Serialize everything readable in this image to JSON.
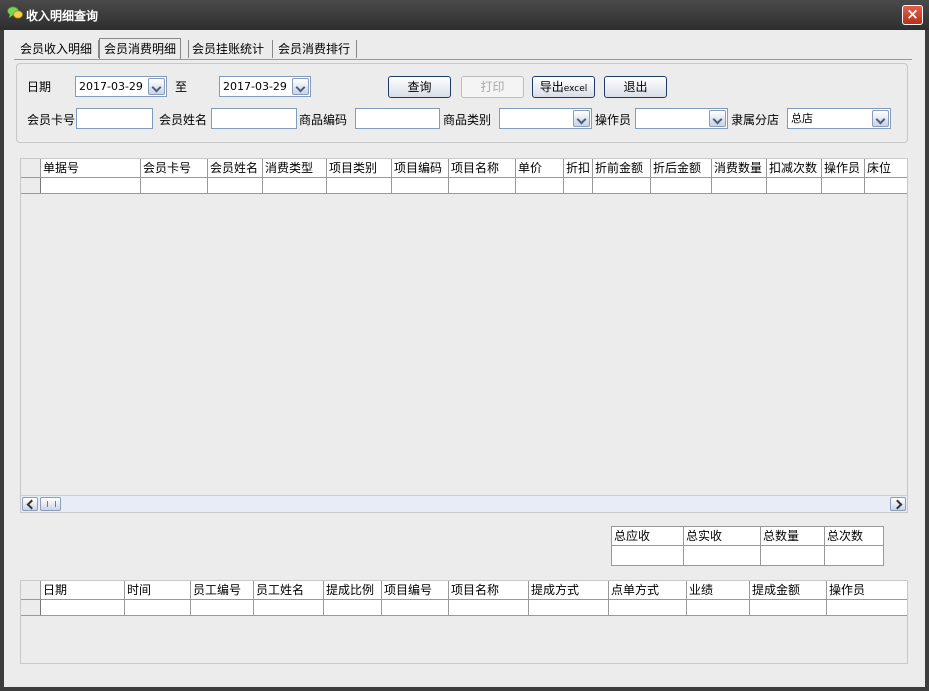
{
  "window": {
    "title": "收入明细查询",
    "close": "×"
  },
  "tabs": [
    "会员收入明细",
    "会员消费明细",
    "会员挂账统计",
    "会员消费排行"
  ],
  "filter": {
    "date_label": "日期",
    "date_from": "2017-03-29",
    "to_label": "至",
    "date_to": "2017-03-29",
    "card_label": "会员卡号",
    "name_label": "会员姓名",
    "code_label": "商品编码",
    "category_label": "商品类别",
    "operator_label": "操作员",
    "branch_label": "隶属分店",
    "branch_value": "总店"
  },
  "buttons": {
    "query": "查询",
    "print": "打印",
    "export_prefix": "导出",
    "export_suffix": "excel",
    "exit": "退出"
  },
  "main_grid": {
    "columns": [
      "单据号",
      "会员卡号",
      "会员姓名",
      "消费类型",
      "项目类别",
      "项目编码",
      "项目名称",
      "单价",
      "折扣",
      "折前金额",
      "折后金额",
      "消费数量",
      "扣减次数",
      "操作员",
      "床位"
    ]
  },
  "totals": {
    "columns": [
      "总应收",
      "总实收",
      "总数量",
      "总次数"
    ]
  },
  "detail_grid": {
    "columns": [
      "日期",
      "时间",
      "员工编号",
      "员工姓名",
      "提成比例",
      "项目编号",
      "项目名称",
      "提成方式",
      "点单方式",
      "业绩",
      "提成金额",
      "操作员"
    ]
  }
}
